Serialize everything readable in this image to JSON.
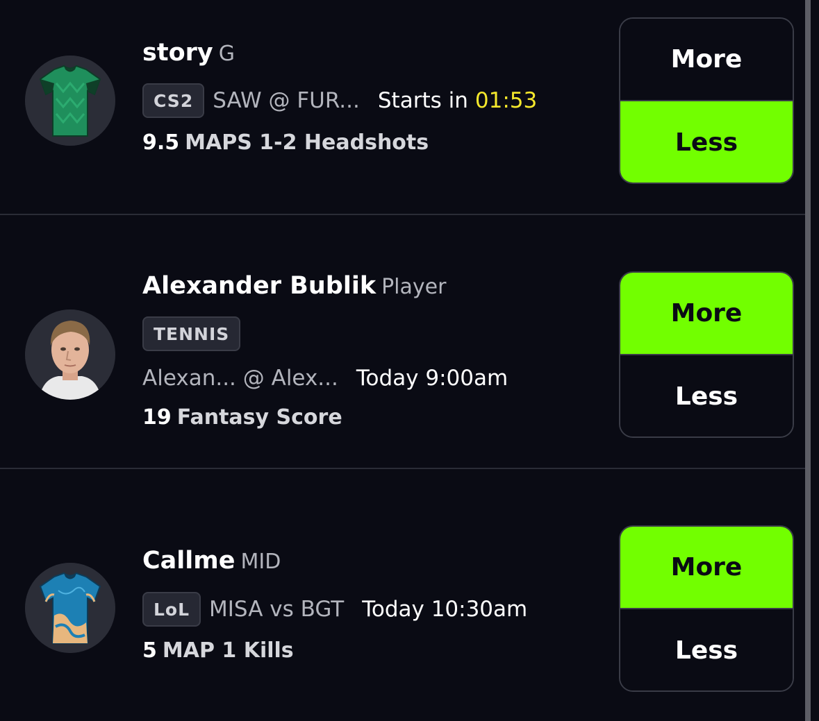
{
  "colors": {
    "background": "#0a0b14",
    "selected_green": "#72ff00",
    "countdown_yellow": "#f5e82c",
    "badge_bg": "#262833"
  },
  "picks": [
    {
      "player_name": "story",
      "position": "G",
      "league": "CS2",
      "matchup": "SAW @ FUR...",
      "start_label": "Starts in",
      "start_time": "01:53",
      "projection_value": "9.5",
      "projection_stat": "MAPS 1-2 Headshots",
      "avatar_icon": "green-jersey-icon",
      "more_label": "More",
      "less_label": "Less",
      "selected": "less"
    },
    {
      "player_name": "Alexander Bublik",
      "position": "Player",
      "league": "TENNIS",
      "matchup": "Alexan... @ Alex...",
      "start_label": "Today 9:00am",
      "projection_value": "19",
      "projection_stat": "Fantasy Score",
      "avatar_icon": "player-headshot-icon",
      "more_label": "More",
      "less_label": "Less",
      "selected": "more"
    },
    {
      "player_name": "Callme",
      "position": "MID",
      "league": "LoL",
      "matchup": "MISA vs BGT",
      "start_label": "Today 10:30am",
      "projection_value": "5",
      "projection_stat": "MAP 1 Kills",
      "avatar_icon": "blue-jersey-icon",
      "more_label": "More",
      "less_label": "Less",
      "selected": "more"
    }
  ]
}
